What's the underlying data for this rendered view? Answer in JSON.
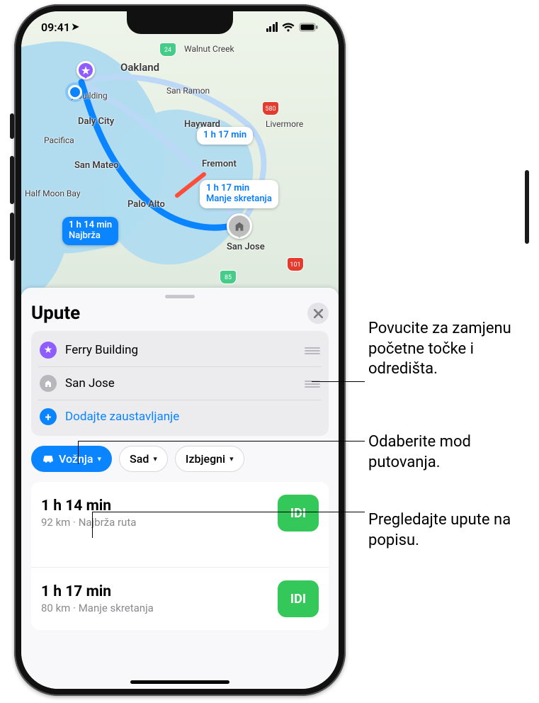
{
  "status": {
    "time": "09:41"
  },
  "map": {
    "cities": {
      "walnut_creek": "Walnut Creek",
      "oakland": "Oakland",
      "san_ramon": "San Ramon",
      "pacifica": "Pacifica",
      "daly_city": "Daly City",
      "ferry_building_pin": "y Building",
      "san_mateo": "San Mateo",
      "hayward": "Hayward",
      "livermore": "Livermore",
      "fremont": "Fremont",
      "half_moon_bay": "Half Moon Bay",
      "palo_alto": "Palo Alto",
      "san_jose": "San Jose"
    },
    "shields": {
      "s24": "24",
      "s580": "580",
      "s101": "101",
      "s85": "85"
    },
    "route_callouts": [
      {
        "time": "1 h 14 min",
        "sub": "Najbrža",
        "selected": true
      },
      {
        "time": "1 h 17 min",
        "sub": "Manje skretanja",
        "selected": false
      },
      {
        "time": "1 h 17 min",
        "sub": "",
        "selected": false
      }
    ]
  },
  "sheet": {
    "title": "Upute",
    "waypoints": {
      "start": "Ferry Building",
      "end": "San Jose",
      "add_stop": "Dodajte zaustavljanje"
    },
    "modes": {
      "drive": "Vožnja",
      "now": "Sad",
      "avoid": "Izbjegni"
    },
    "routes": [
      {
        "time": "1 h 14 min",
        "subtitle": "92 km · Najbrža ruta",
        "go": "IDI"
      },
      {
        "time": "1 h 17 min",
        "subtitle": "80 km · Manje skretanja",
        "go": "IDI"
      }
    ]
  },
  "annotations": {
    "swap": "Povucite za zamjenu početne točke i odredišta.",
    "mode": "Odaberite mod putovanja.",
    "list": "Pregledajte upute na popisu."
  }
}
